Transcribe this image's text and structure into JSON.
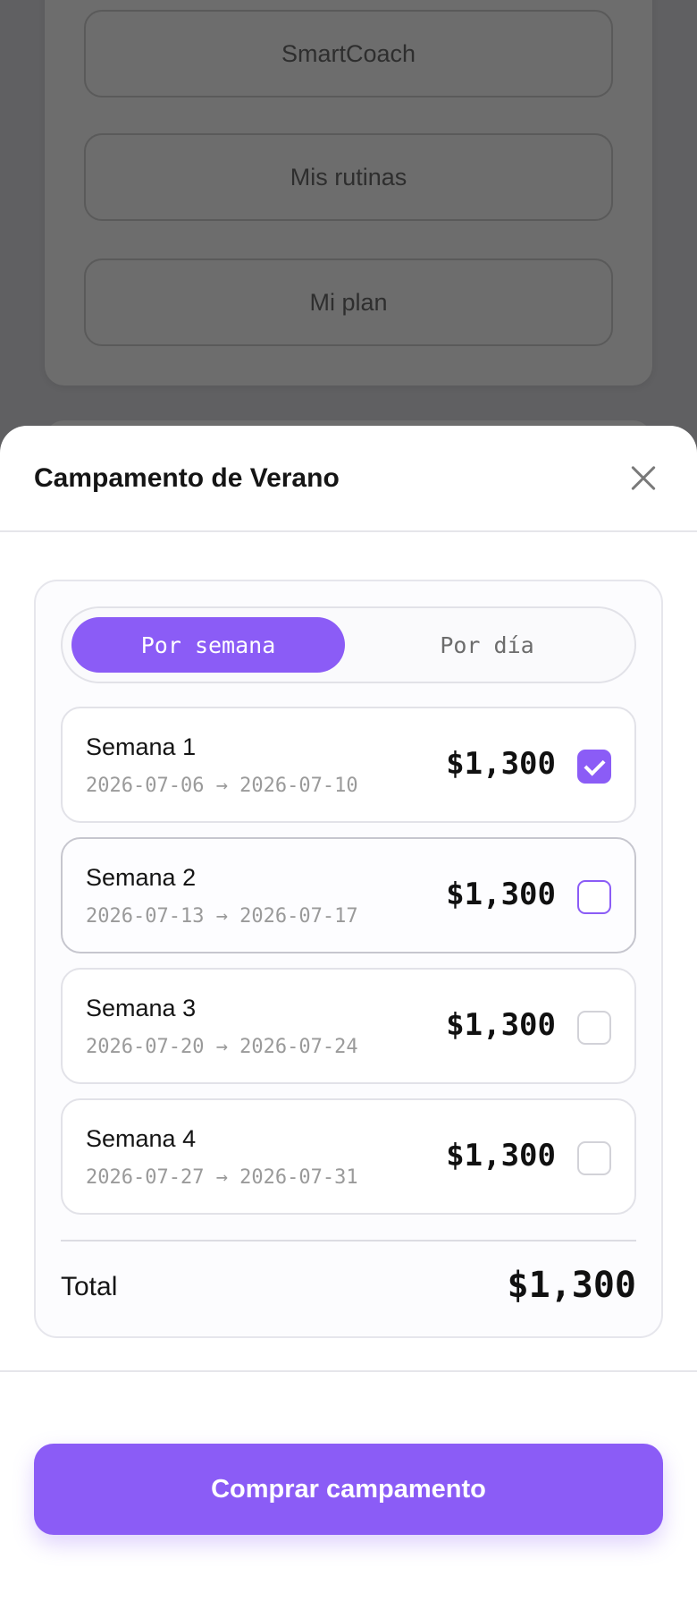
{
  "background": {
    "buttons": [
      "SmartCoach",
      "Mis rutinas",
      "Mi plan"
    ]
  },
  "sheet": {
    "title": "Campamento de Verano",
    "close_icon": "close-icon"
  },
  "toggle": {
    "per_week": "Por semana",
    "per_day": "Por día",
    "selected": "per_week"
  },
  "weeks": [
    {
      "name": "Semana 1",
      "dates": "2026-07-06 → 2026-07-10",
      "price": "$1,300",
      "checked": true
    },
    {
      "name": "Semana 2",
      "dates": "2026-07-13 → 2026-07-17",
      "price": "$1,300",
      "checked": false
    },
    {
      "name": "Semana 3",
      "dates": "2026-07-20 → 2026-07-24",
      "price": "$1,300",
      "checked": false
    },
    {
      "name": "Semana 4",
      "dates": "2026-07-27 → 2026-07-31",
      "price": "$1,300",
      "checked": false
    }
  ],
  "total": {
    "label": "Total",
    "value": "$1,300"
  },
  "cta": {
    "label": "Comprar campamento"
  },
  "colors": {
    "accent": "#8b5cf6",
    "overlay": "#606062"
  }
}
